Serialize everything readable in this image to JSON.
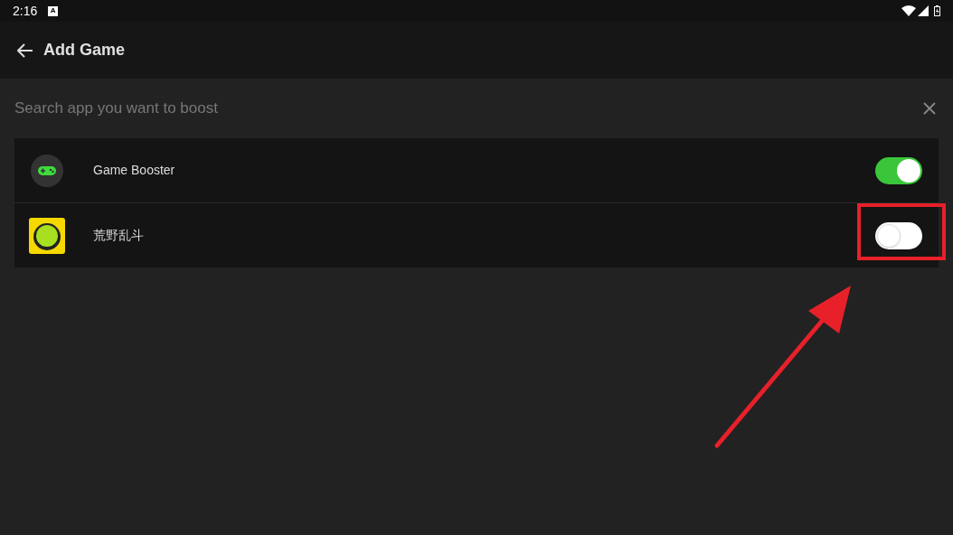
{
  "status_bar": {
    "time": "2:16",
    "notification": "A"
  },
  "header": {
    "title": "Add Game"
  },
  "search": {
    "placeholder": "Search app you want to boost"
  },
  "apps": [
    {
      "name": "Game Booster",
      "kind": "gamepad",
      "on": true,
      "highlighted": false
    },
    {
      "name": "荒野乱斗",
      "kind": "game",
      "on": false,
      "highlighted": true
    }
  ]
}
